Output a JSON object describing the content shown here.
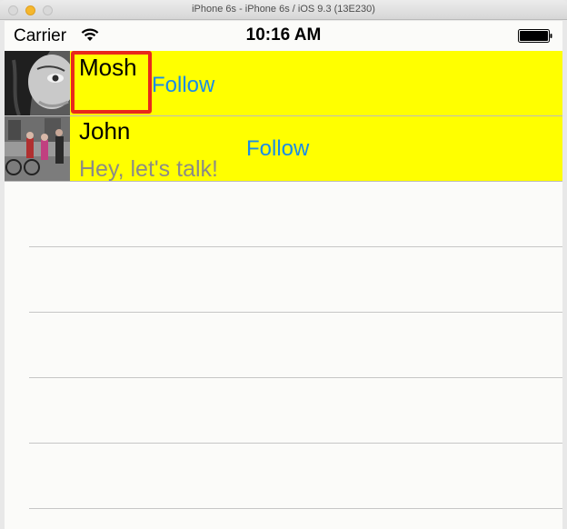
{
  "window": {
    "title": "iPhone 6s - iPhone 6s / iOS 9.3 (13E230)"
  },
  "statusbar": {
    "carrier": "Carrier",
    "time": "10:16 AM"
  },
  "colors": {
    "cell_background": "#ffff00",
    "follow_link": "#1a8ce6",
    "highlight_border": "#e8281c",
    "message_text": "#8c8c85"
  },
  "table": {
    "rows": [
      {
        "name": "Mosh",
        "message": "",
        "follow_label": "Follow",
        "avatar": "avatar-photo"
      },
      {
        "name": "John",
        "message": "Hey, let's talk!",
        "follow_label": "Follow",
        "avatar": "avatar-photo"
      }
    ]
  }
}
